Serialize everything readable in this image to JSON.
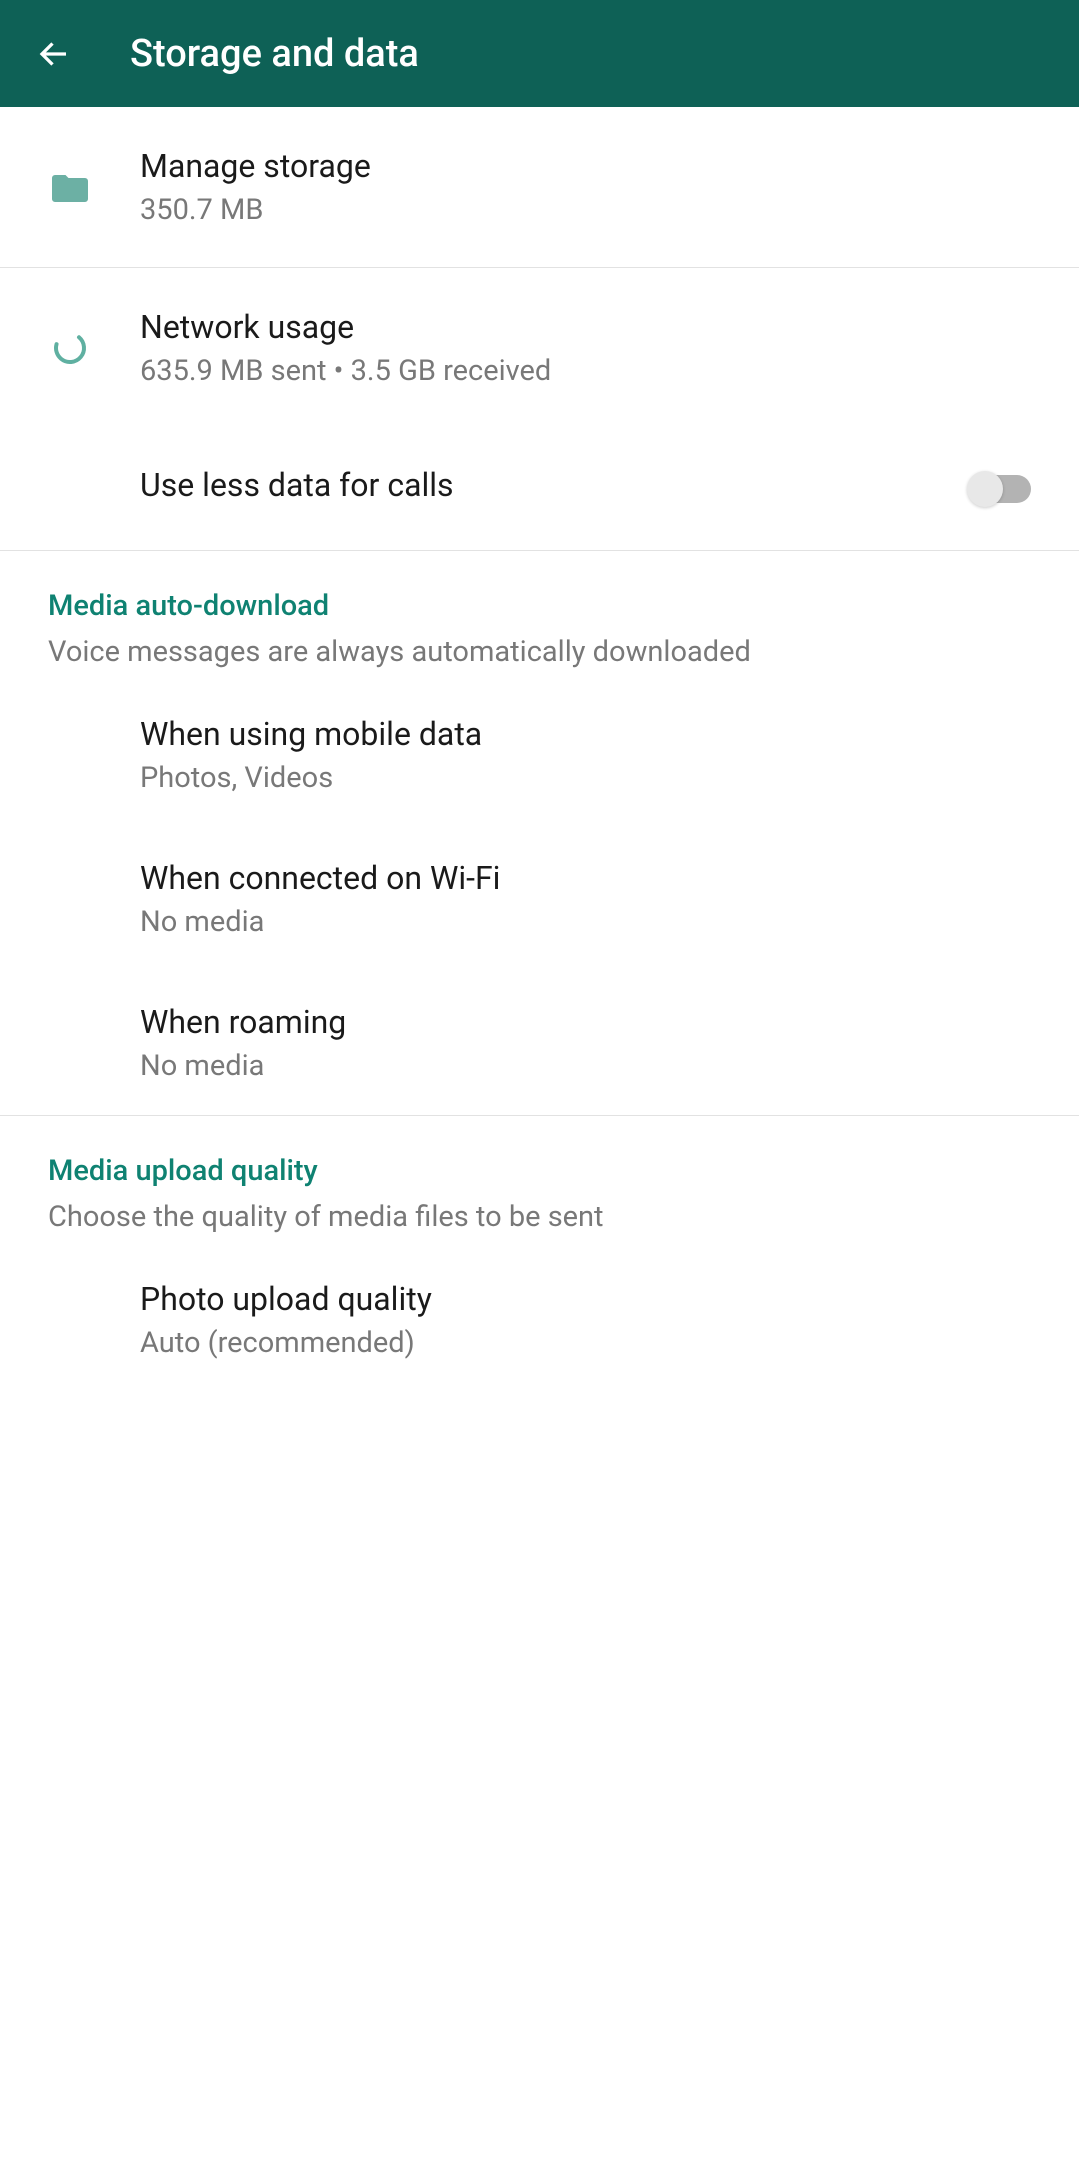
{
  "header": {
    "title": "Storage and data"
  },
  "manage_storage": {
    "title": "Manage storage",
    "subtitle": "350.7 MB"
  },
  "network_usage": {
    "title": "Network usage",
    "subtitle": "635.9 MB sent • 3.5 GB received"
  },
  "use_less_data": {
    "title": "Use less data for calls",
    "enabled": false
  },
  "media_auto_download": {
    "section_title": "Media auto-download",
    "section_desc": "Voice messages are always automatically downloaded",
    "mobile_data": {
      "title": "When using mobile data",
      "subtitle": "Photos, Videos"
    },
    "wifi": {
      "title": "When connected on Wi-Fi",
      "subtitle": "No media"
    },
    "roaming": {
      "title": "When roaming",
      "subtitle": "No media"
    }
  },
  "media_upload_quality": {
    "section_title": "Media upload quality",
    "section_desc": "Choose the quality of media files to be sent",
    "photo": {
      "title": "Photo upload quality",
      "subtitle": "Auto (recommended)"
    }
  }
}
